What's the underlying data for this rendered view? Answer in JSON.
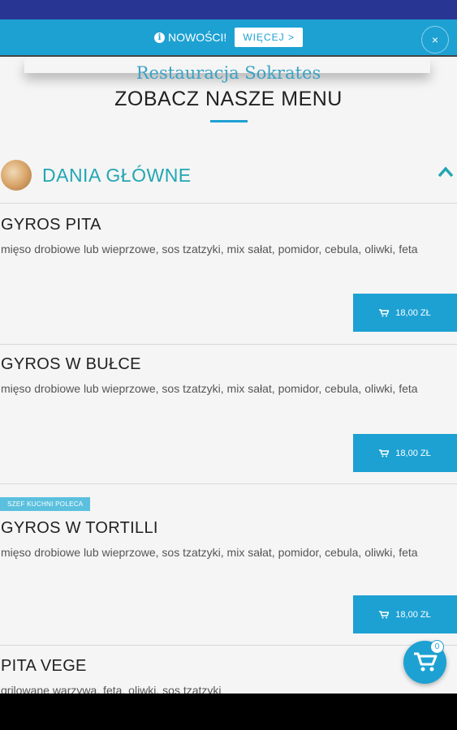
{
  "notice": {
    "text": "NOWOŚCI!",
    "more_label": "WIĘCEJ >",
    "close_label": "×"
  },
  "header": {
    "restaurant_name": "Restauracja Sokrates",
    "title": "ZOBACZ NASZE MENU"
  },
  "category": {
    "title": "DANIA GŁÓWNE"
  },
  "items": [
    {
      "name": "GYROS PITA",
      "description": "mięso drobiowe lub wieprzowe, sos tzatzyki, mix sałat, pomidor, cebula, oliwki, feta",
      "price": "18,00 ZŁ",
      "badge": ""
    },
    {
      "name": "GYROS W BUŁCE",
      "description": "mięso drobiowe lub wieprzowe, sos tzatzyki, mix sałat, pomidor, cebula, oliwki, feta",
      "price": "18,00 ZŁ",
      "badge": ""
    },
    {
      "name": "GYROS W TORTILLI",
      "description": "mięso drobiowe lub wieprzowe, sos tzatzyki, mix sałat, pomidor, cebula, oliwki, feta",
      "price": "18,00 ZŁ",
      "badge": "SZEF KUCHNI POLECA"
    },
    {
      "name": "PITA VEGE",
      "description": "grilowane warzywa, feta, oliwki, sos tzatzyki",
      "price": "",
      "badge": ""
    }
  ],
  "cart": {
    "count": "0"
  },
  "colors": {
    "accent": "#1da1d3",
    "category": "#22a6b3",
    "status_bar": "#283593"
  }
}
